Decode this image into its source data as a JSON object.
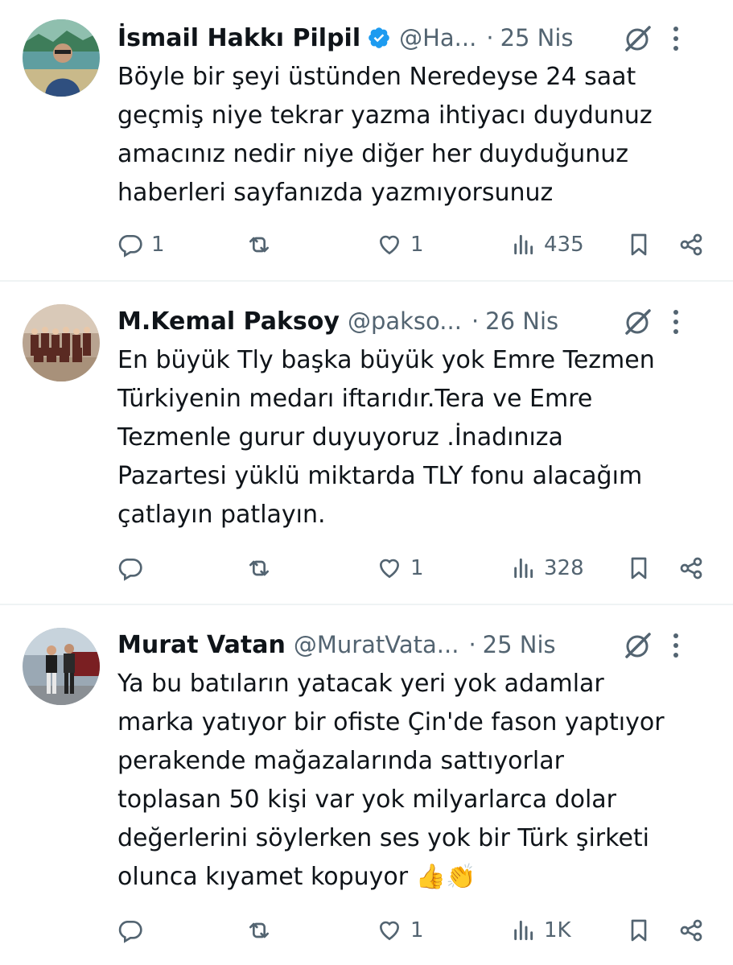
{
  "colors": {
    "text": "#0f1419",
    "secondary": "#536471",
    "verified": "#1d9bf0",
    "divider": "#eff3f4"
  },
  "tweets": [
    {
      "name": "İsmail Hakkı Pilpil",
      "verified": true,
      "handle": "@Ha...",
      "dot": "·",
      "date": "25 Nis",
      "text": "Böyle bir şeyi üstünden Neredeyse 24 saat\ngeçmiş niye tekrar yazma ihtiyacı duydunuz\namacınız  nedir niye diğer her duyduğunuz\nhaberleri  sayfanızda yazmıyorsunuz",
      "replies": "1",
      "reposts": "",
      "likes": "1",
      "views": "435",
      "avatar_icon": "profile-photo"
    },
    {
      "name": "M.Kemal Paksoy",
      "verified": false,
      "handle": "@pakso...",
      "dot": "·",
      "date": "26 Nis",
      "text": "En büyük Tly başka büyük yok Emre Tezmen\nTürkiyenin medarı iftarıdır.Tera ve Emre\nTezmenle  gurur duyuyoruz .İnadınıza\nPazartesi yüklü miktarda TLY fonu alacağım\nçatlayın patlayın.",
      "replies": "",
      "reposts": "",
      "likes": "1",
      "views": "328",
      "avatar_icon": "group-photo"
    },
    {
      "name": "Murat Vatan",
      "verified": false,
      "handle": "@MuratVata...",
      "dot": "·",
      "date": "25 Nis",
      "text": "Ya bu batıların yatacak yeri yok adamlar\nmarka yatıyor bir ofiste Çin'de  fason  yaptıyor\nperakende mağazalarında sattıyorlar\ntoplasan  50 kişi var yok milyarlarca dolar\ndeğerlerini söylerken ses yok  bir  Türk şirketi\nolunca kıyamet kopuyor 👍👏",
      "replies": "",
      "reposts": "",
      "likes": "1",
      "views": "1K",
      "avatar_icon": "two-people-photo"
    }
  ]
}
